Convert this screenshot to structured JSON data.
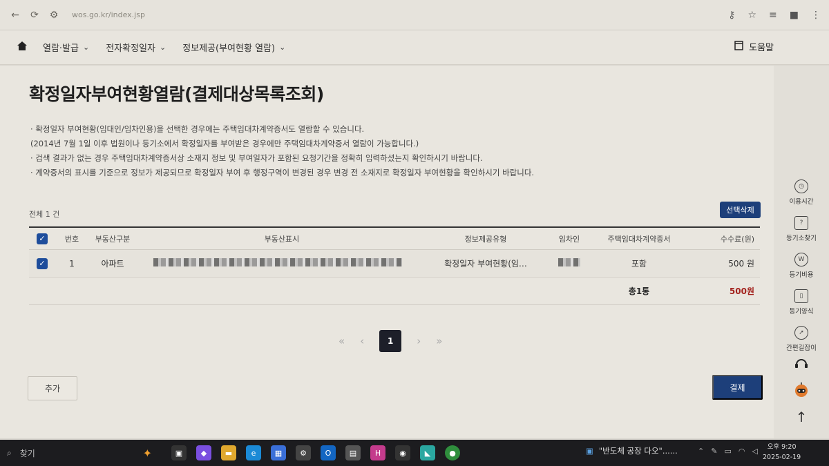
{
  "browser": {
    "url": "wos.go.kr/index.jsp"
  },
  "nav": {
    "items": [
      {
        "label": "열람·발급"
      },
      {
        "label": "전자확정일자"
      },
      {
        "label": "정보제공(부여현황 열람)"
      }
    ],
    "help_label": "도움말"
  },
  "page": {
    "title": "확정일자부여현황열람(결제대상목록조회)",
    "notes": [
      "· 확정일자 부여현황(임대인/임차인용)을 선택한 경우에는 주택임대차계약증서도 열람할 수 있습니다.",
      "  (2014년 7월 1일 이후 법원이나 등기소에서 확정일자를 부여받은 경우에만 주택임대차계약증서 열람이 가능합니다.)",
      "· 검색 결과가 없는 경우 주택임대차계약증서상 소재지 정보 및 부여일자가 포함된 요청기간을 정확히 입력하셨는지 확인하시기 바랍니다.",
      "· 계약증서의 표시를 기준으로 정보가 제공되므로 확정일자 부여 후 행정구역이 변경된 경우 변경 전 소재지로 확정일자 부여현황을 확인하시기 바랍니다."
    ],
    "total_count": "전체 1 건",
    "delete_selected": "선택삭제"
  },
  "table": {
    "headers": {
      "no": "번호",
      "type": "부동산구분",
      "address": "부동산표시",
      "info_type": "정보제공유형",
      "tenant": "임차인",
      "certificate": "주택임대차계약증서",
      "fee": "수수료(원)"
    },
    "rows": [
      {
        "no": "1",
        "type": "아파트",
        "info_type": "확정일자 부여현황(임…",
        "certificate": "포함",
        "fee": "500 원"
      }
    ],
    "footer": {
      "total_label": "총1통",
      "total_fee": "500원"
    }
  },
  "pagination": {
    "first": "«",
    "prev": "‹",
    "current": "1",
    "next": "›",
    "last": "»"
  },
  "buttons": {
    "add": "추가",
    "pay": "결제"
  },
  "quick_menu": [
    {
      "label": "이용시간",
      "icon": "clock-icon"
    },
    {
      "label": "등기소찾기",
      "icon": "map-book-icon"
    },
    {
      "label": "등기비용",
      "icon": "won-icon"
    },
    {
      "label": "등기양식",
      "icon": "form-icon"
    },
    {
      "label": "간편길잡이",
      "icon": "compass-icon"
    }
  ],
  "taskbar": {
    "search": "찾기",
    "news": "\"반도체 공장 다오\"......",
    "time": "오후 9:20",
    "date": "2025-02-19"
  }
}
